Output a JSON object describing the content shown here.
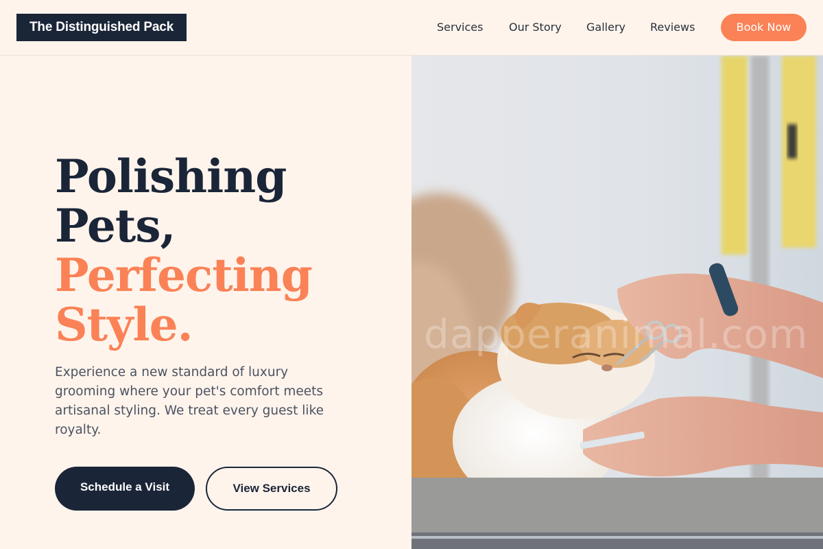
{
  "header": {
    "brand": "The Distinguished Pack",
    "nav": [
      {
        "label": "Services"
      },
      {
        "label": "Our Story"
      },
      {
        "label": "Gallery"
      },
      {
        "label": "Reviews"
      }
    ],
    "cta": "Book Now"
  },
  "hero": {
    "headline": {
      "line1": "Polishing",
      "line2": "Pets,",
      "line3": "Perfecting",
      "line4": "Style."
    },
    "description": "Experience a new standard of luxury grooming where your pet's comfort meets artisanal styling. We treat every guest like royalty.",
    "primary_button": "Schedule a Visit",
    "secondary_button": "View Services",
    "image": {
      "subject": "fluffy orange and white Persian cat being groomed with scissors",
      "watermark": "dapperanimal.com"
    }
  },
  "colors": {
    "background": "#fef4ec",
    "navy": "#1b2538",
    "accent": "#fa8256",
    "body_text": "#4b5260"
  }
}
